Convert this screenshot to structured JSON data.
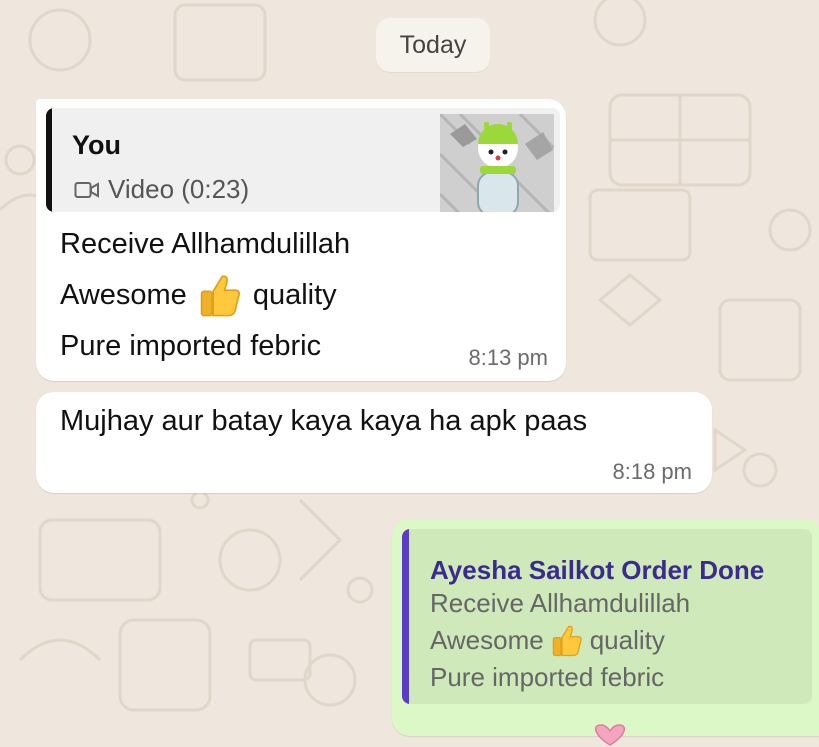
{
  "date_separator": "Today",
  "messages": [
    {
      "direction": "incoming",
      "quote": {
        "author": "You",
        "media_label": "Video (0:23)",
        "icon": "video-camera-icon"
      },
      "lines": [
        "Receive Allhamdulillah",
        "Awesome",
        "quality",
        "Pure imported febric"
      ],
      "time": "8:13 pm"
    },
    {
      "direction": "incoming",
      "lines": [
        "Mujhay aur batay kaya kaya ha apk paas"
      ],
      "time": "8:18 pm"
    },
    {
      "direction": "outgoing",
      "quote": {
        "author": "Ayesha Sailkot Order Done",
        "lines": [
          "Receive Allhamdulillah",
          "Awesome",
          "quality",
          "Pure imported febric"
        ]
      }
    }
  ],
  "colors": {
    "wallpaper": "#efe7dd",
    "incoming_bubble": "#ffffff",
    "outgoing_bubble": "#dcf8c6",
    "quote_bar_out": "#5b3cc4",
    "quote_author_out": "#3b2b8e"
  }
}
